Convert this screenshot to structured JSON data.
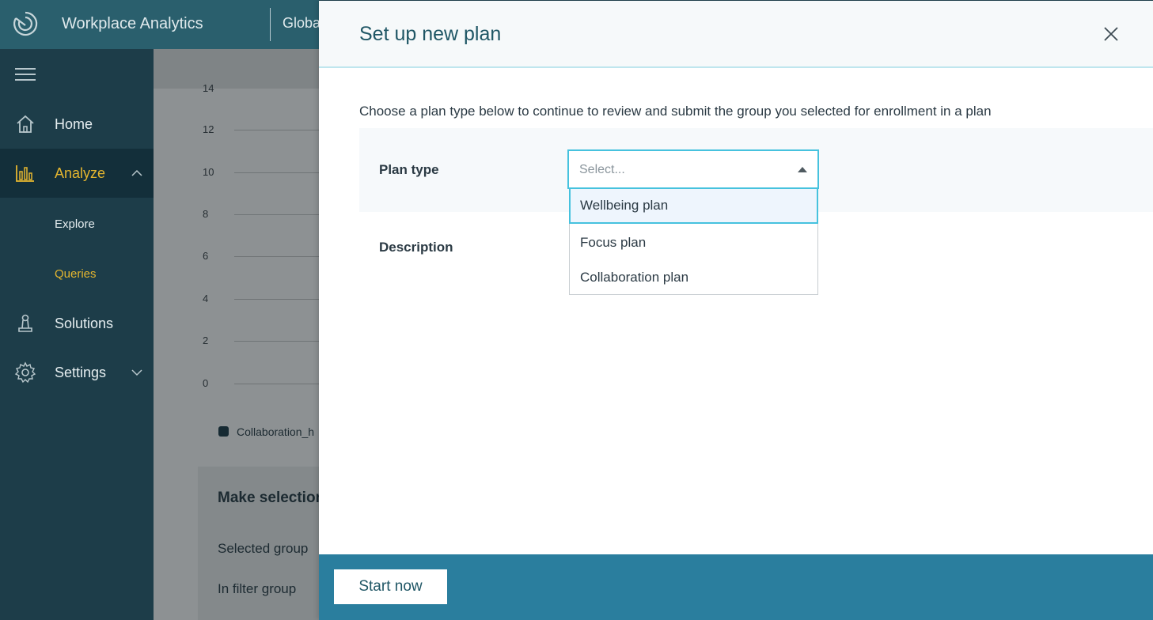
{
  "header": {
    "app_title": "Workplace Analytics",
    "scope_label": "Globa"
  },
  "sidebar": {
    "items": [
      {
        "label": "Home",
        "icon": "home-icon"
      },
      {
        "label": "Analyze",
        "icon": "bar-chart-icon",
        "active": true,
        "expanded": true
      },
      {
        "label": "Explore",
        "sub": true
      },
      {
        "label": "Queries",
        "sub": true,
        "active": true
      },
      {
        "label": "Solutions",
        "icon": "solutions-icon"
      },
      {
        "label": "Settings",
        "icon": "gear-icon"
      }
    ]
  },
  "background": {
    "y_ticks": [
      "14",
      "12",
      "10",
      "8",
      "6",
      "4",
      "2",
      "0"
    ],
    "legend_label": "Collaboration_h",
    "selection_title": "Make selection",
    "selected_group_label": "Selected group",
    "in_filter_group_label": "In filter group"
  },
  "panel": {
    "title": "Set up new plan",
    "instructions": "Choose a plan type below to continue to review and submit the group you selected for enrollment in a plan",
    "plan_type_label": "Plan type",
    "description_label": "Description",
    "select_placeholder": "Select...",
    "options": [
      "Wellbeing plan",
      "Focus plan",
      "Collaboration plan"
    ],
    "highlighted_option": "Wellbeing plan",
    "start_button": "Start now"
  },
  "colors": {
    "topbar": "#2a5f6d",
    "sidebar": "#1d3d49",
    "accent_active": "#e5b62f",
    "focus_border": "#46c2de",
    "footer": "#2a7e9e"
  }
}
